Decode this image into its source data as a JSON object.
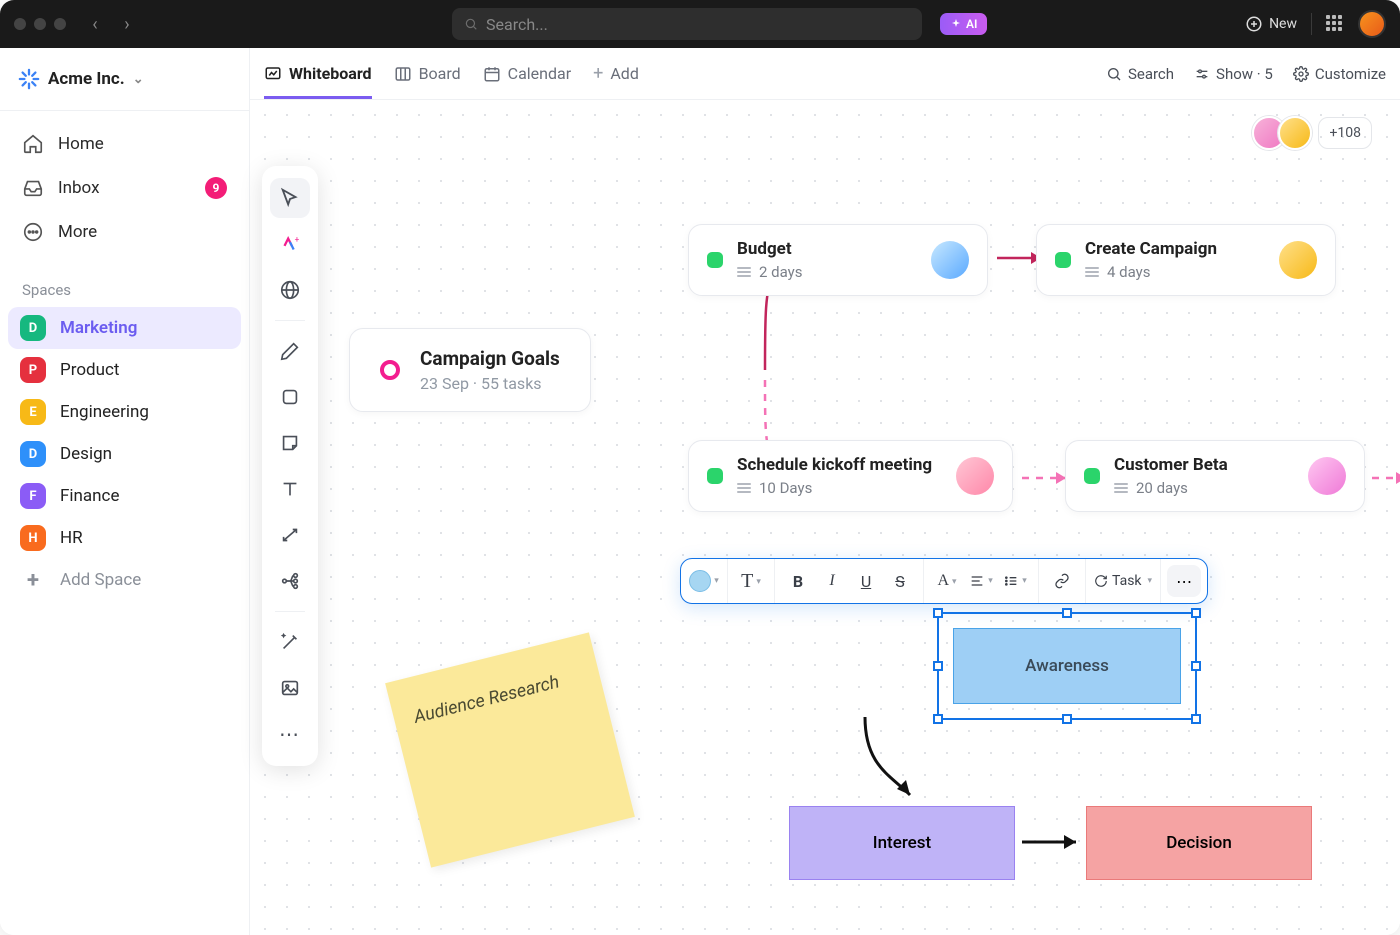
{
  "topbar": {
    "search_placeholder": "Search...",
    "ai_label": "AI",
    "new_label": "New"
  },
  "workspace": {
    "name": "Acme Inc."
  },
  "nav": {
    "home": "Home",
    "inbox": "Inbox",
    "inbox_badge": "9",
    "more": "More"
  },
  "spaces": {
    "label": "Spaces",
    "items": [
      {
        "letter": "D",
        "name": "Marketing",
        "color": "#16b87f",
        "active": true
      },
      {
        "letter": "P",
        "name": "Product",
        "color": "#e5303e"
      },
      {
        "letter": "E",
        "name": "Engineering",
        "color": "#f7b917"
      },
      {
        "letter": "D",
        "name": "Design",
        "color": "#2e90fa"
      },
      {
        "letter": "F",
        "name": "Finance",
        "color": "#8b5cf6"
      },
      {
        "letter": "H",
        "name": "HR",
        "color": "#f96b1e"
      }
    ],
    "add_label": "Add Space"
  },
  "tabs": {
    "whiteboard": "Whiteboard",
    "board": "Board",
    "calendar": "Calendar",
    "add": "Add"
  },
  "tabs_right": {
    "search": "Search",
    "show": "Show · 5",
    "customize": "Customize"
  },
  "collaborators": {
    "extra_count": "+108"
  },
  "cards": {
    "root": {
      "title": "Campaign Goals",
      "meta": "23 Sep  ·  55 tasks"
    },
    "budget": {
      "title": "Budget",
      "meta": "2 days"
    },
    "campaign": {
      "title": "Create Campaign",
      "meta": "4 days"
    },
    "kickoff": {
      "title": "Schedule kickoff meeting",
      "meta": "10 Days"
    },
    "beta": {
      "title": "Customer Beta",
      "meta": "20 days"
    }
  },
  "sticky": {
    "text": "Audience Research"
  },
  "shapes": {
    "awareness": "Awareness",
    "interest": "Interest",
    "decision": "Decision"
  },
  "format_toolbar": {
    "task_label": "Task"
  }
}
